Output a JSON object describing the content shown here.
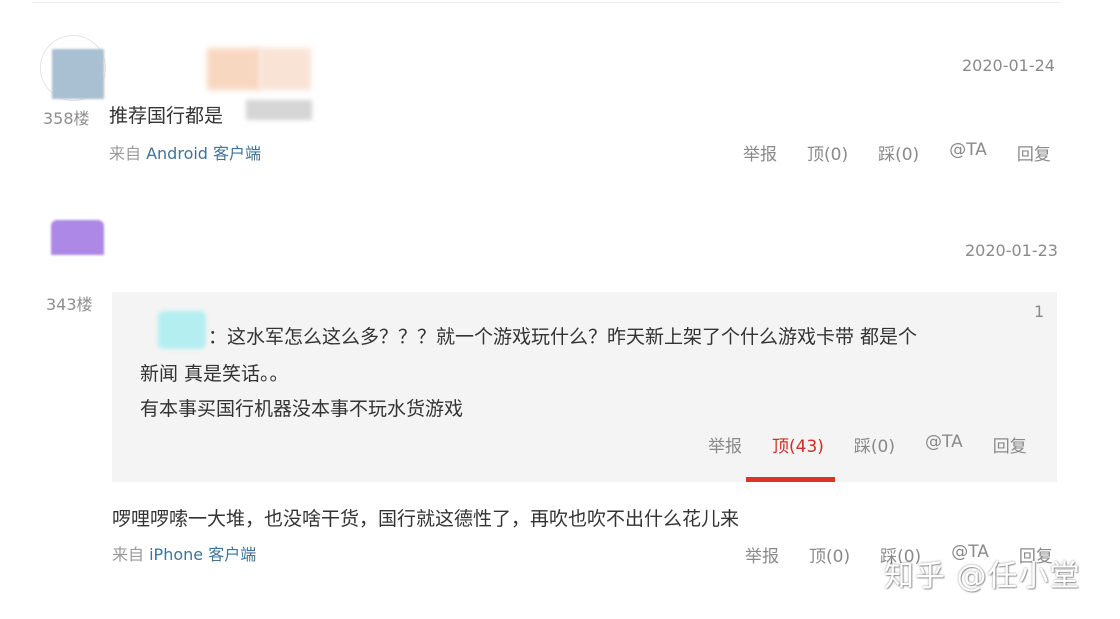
{
  "posts": [
    {
      "floor": "358楼",
      "date": "2020-01-24",
      "content": "推荐国行都是",
      "source_prefix": "来自 ",
      "source_client": "Android 客户端",
      "actions": {
        "report": "举报",
        "up": "顶(0)",
        "down": "踩(0)",
        "at": "@TA",
        "reply": "回复"
      }
    },
    {
      "floor": "343楼",
      "date": "2020-01-23",
      "quote": {
        "number": "1",
        "line1": "：这水军怎么这么多？？？就一个游戏玩什么？昨天新上架了个什么游戏卡带 都是个",
        "line2": "新闻 真是笑话。。",
        "line3": "有本事买国行机器没本事不玩水货游戏",
        "actions": {
          "report": "举报",
          "up": "顶(43)",
          "down": "踩(0)",
          "at": "@TA",
          "reply": "回复"
        }
      },
      "content": "啰哩啰嗦一大堆，也没啥干货，国行就这德性了，再吹也吹不出什么花儿来",
      "source_prefix": "来自 ",
      "source_client": "iPhone 客户端",
      "actions": {
        "report": "举报",
        "up": "顶(0)",
        "down": "踩(0)",
        "at": "@TA",
        "reply": "回复"
      }
    }
  ],
  "watermark": "知乎 @任小堂",
  "colors": {
    "link": "#3f7399",
    "active": "#cf2f22",
    "underline": "#e0331f",
    "quote_bg": "#f4f4f4"
  }
}
